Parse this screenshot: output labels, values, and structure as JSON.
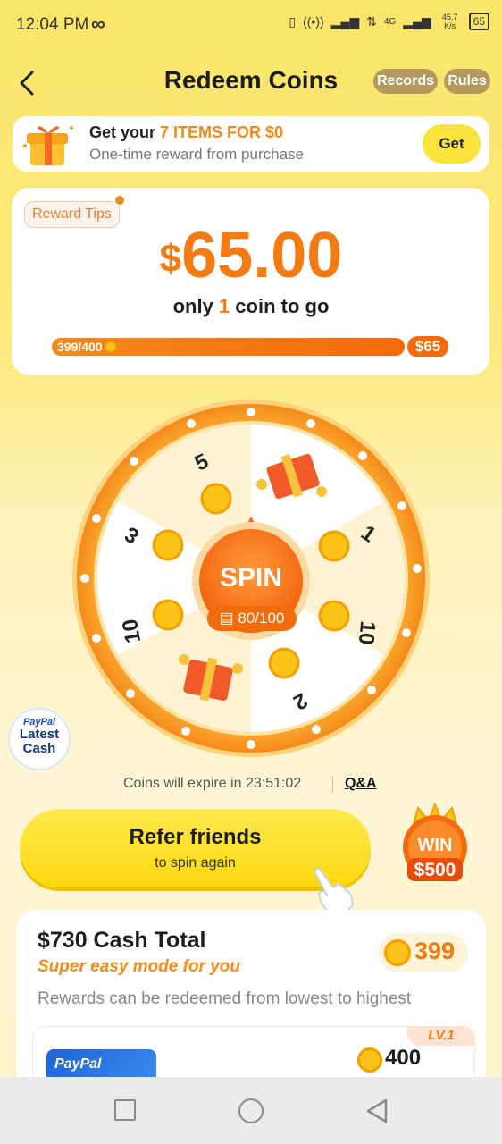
{
  "status_bar": {
    "time": "12:04 PM",
    "infinity": "∞",
    "network": "4G",
    "speed": "45.7 K/s",
    "battery": "65"
  },
  "header": {
    "title": "Redeem Coins",
    "records_label": "Records",
    "rules_label": "Rules"
  },
  "promo": {
    "title_prefix": "Get your ",
    "title_highlight": "7 ITEMS FOR $0",
    "subtitle": "One-time reward from purchase",
    "button_label": "Get"
  },
  "reward": {
    "tips_label": "Reward Tips",
    "currency": "$",
    "amount": "65.00",
    "togo_prefix": "only ",
    "togo_count": "1",
    "togo_suffix": " coin to go",
    "progress_label": "399/400",
    "progress_fraction": 0.9975,
    "goal_label": "$65"
  },
  "wheel": {
    "segments": [
      "1",
      "10",
      "2",
      "10",
      "3",
      "5"
    ],
    "spin_label": "SPIN",
    "spin_count": "80/100"
  },
  "paypal_badge": {
    "brand": "PayPal",
    "line1": "Latest",
    "line2": "Cash"
  },
  "expire": {
    "text": "Coins will expire in 23:51:02",
    "qa_label": "Q&A"
  },
  "refer": {
    "title": "Refer friends",
    "subtitle": "to spin again"
  },
  "win_badge": {
    "line1": "WIN",
    "line2": "$500"
  },
  "cash": {
    "title": "$730 Cash Total",
    "subtitle": "Super easy mode for you",
    "coin_balance": "399",
    "description": "Rewards can be redeemed from lowest to highest",
    "level_tag": "LV.1",
    "level_brand": "PayPal",
    "level_cost": "400"
  },
  "colors": {
    "accent": "#f47a12",
    "yellow": "#fbe33b",
    "pill": "#b59a5f"
  }
}
